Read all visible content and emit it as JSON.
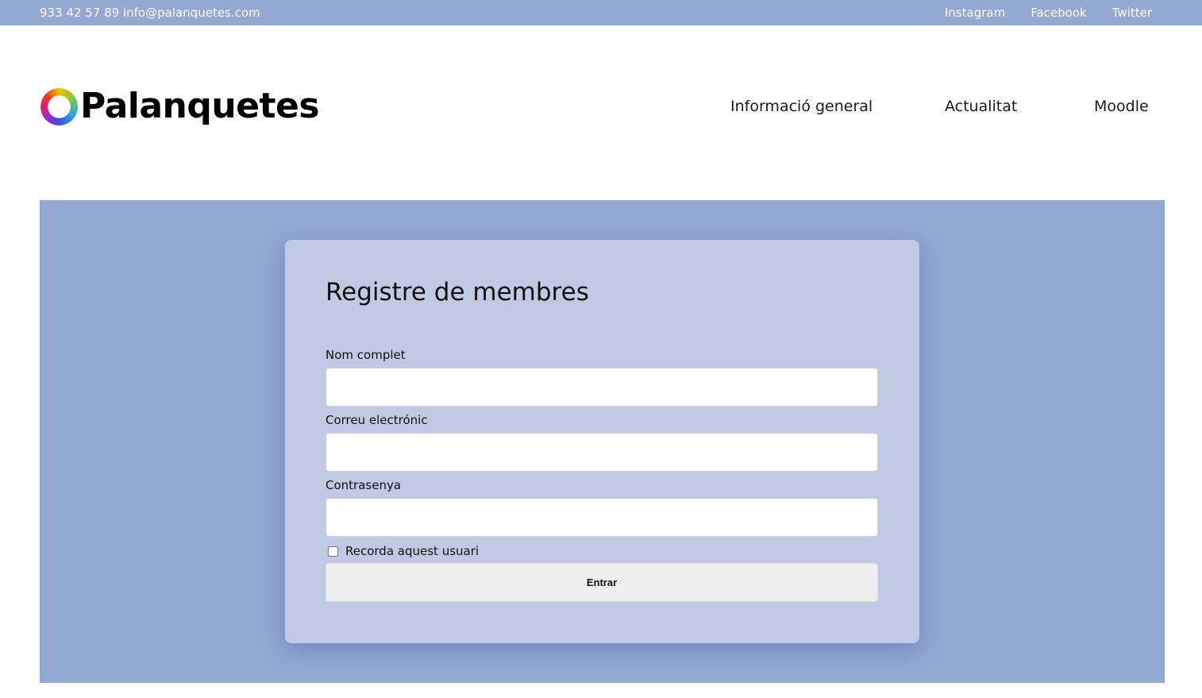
{
  "topbar": {
    "contact": "933 42 57 89 info@palanquetes.com",
    "social": [
      "Instagram",
      "Facebook",
      "Twitter"
    ]
  },
  "header": {
    "logo_text": "Palanquetes",
    "nav": [
      "Informació general",
      "Actualitat",
      "Moodle"
    ]
  },
  "form": {
    "title": "Registre de membres",
    "fields": [
      {
        "label": "Nom complet",
        "value": ""
      },
      {
        "label": "Correu electrónic",
        "value": ""
      },
      {
        "label": "Contrasenya",
        "value": ""
      }
    ],
    "remember_label": "Recorda aquest usuari",
    "remember_checked": false,
    "submit_label": "Entrar"
  },
  "colors": {
    "accent": "#93a8d3",
    "card": "#c0cbe3"
  }
}
